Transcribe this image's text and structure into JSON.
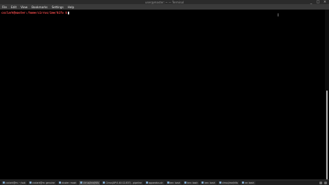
{
  "window": {
    "title": "user@master: ~ — Terminal",
    "controls": [
      "_",
      "□",
      "×"
    ]
  },
  "menubar": {
    "items": [
      "File",
      "Edit",
      "View",
      "Bookmarks",
      "Settings",
      "Help"
    ]
  },
  "terminal": {
    "prompt": "cxclark@master:/home/cirrus/ime/hifo $"
  },
  "taskbar": {
    "tasks": [
      {
        "label": "cxclark@m: ~/sub",
        "active": false
      },
      {
        "label": "cxclark@m: genuine",
        "active": false
      },
      {
        "label": "cluster: mash",
        "active": false
      },
      {
        "label": "cirrus/ime/hifo",
        "active": true
      },
      {
        "label": "Cirrus(UP:0.40:12.837) - pipeline",
        "active": false
      },
      {
        "label": "apparatus.sh",
        "active": false
      },
      {
        "label": "ken: bash",
        "active": false
      },
      {
        "label": "ken: bash",
        "active": false
      },
      {
        "label": "ken: bash",
        "active": false
      },
      {
        "label": "cirrus/ime/hifo",
        "active": false
      },
      {
        "label": "ne: bash",
        "active": false
      }
    ]
  },
  "colors": {
    "prompt": "#ff4f4f",
    "background": "#000000",
    "menubar": "#3a3a3a"
  }
}
